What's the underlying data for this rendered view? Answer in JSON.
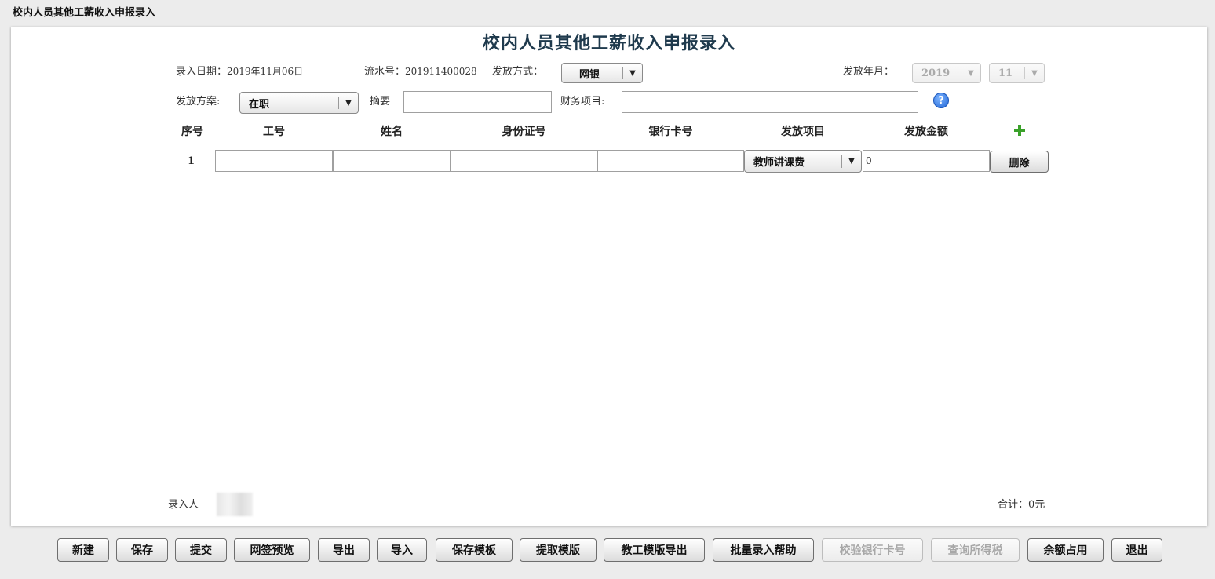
{
  "window": {
    "title": "校内人员其他工薪收入申报录入"
  },
  "form": {
    "title": "校内人员其他工薪收入申报录入",
    "entry_date_label": "录入日期：",
    "entry_date": "2019年11月06日",
    "serial_label": "流水号：",
    "serial_no": "201911400028",
    "pay_method_label": "发放方式：",
    "pay_method": "网银",
    "pay_month_label": "发放年月：",
    "pay_year": "2019",
    "pay_month": "11",
    "plan_label": "发放方案:",
    "plan": "在职",
    "summary_label": "摘要",
    "summary_value": "",
    "finance_label": "财务项目:",
    "finance_value": "",
    "help_icon_glyph": "?"
  },
  "table": {
    "headers": [
      "序号",
      "工号",
      "姓名",
      "身份证号",
      "银行卡号",
      "发放项目",
      "发放金额"
    ],
    "rows": [
      {
        "no": "1",
        "staff_id": "",
        "name": "",
        "id_card": "",
        "bank_card": "",
        "item": "教师讲课费",
        "amount": "0",
        "delete_label": "删除"
      }
    ]
  },
  "footer_info": {
    "entered_by_label": "录入人",
    "total_label": "合计：",
    "total_value": "0元"
  },
  "buttons": {
    "new": "新建",
    "save": "保存",
    "submit": "提交",
    "sign_preview": "网签预览",
    "export": "导出",
    "import": "导入",
    "save_template": "保存模板",
    "fetch_template": "提取模版",
    "staff_template_export": "教工模版导出",
    "batch_help": "批量录入帮助",
    "verify_bank_card": "校验银行卡号",
    "query_tax": "查询所得税",
    "balance_use": "余额占用",
    "exit": "退出"
  }
}
